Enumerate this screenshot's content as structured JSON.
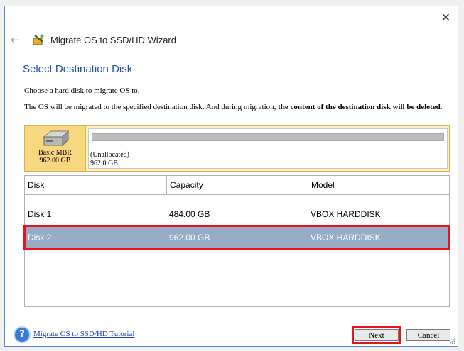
{
  "window": {
    "title": "Migrate OS to SSD/HD Wizard",
    "close_glyph": "✕"
  },
  "page": {
    "heading": "Select Destination Disk",
    "instruction": "Choose a hard disk to migrate OS to.",
    "warning_prefix": "The OS will be migrated to the specified destination disk. And during migration, ",
    "warning_bold": "the content of the destination disk will be deleted",
    "warning_suffix": "."
  },
  "disk_map": {
    "disk_type": "Basic MBR",
    "disk_size": "962.00 GB",
    "partition_label": "(Unallocated)",
    "partition_size": "962.0 GB"
  },
  "table": {
    "columns": [
      "Disk",
      "Capacity",
      "Model"
    ],
    "rows": [
      {
        "disk": "Disk 1",
        "capacity": "484.00 GB",
        "model": "VBOX HARDDISK"
      },
      {
        "disk": "Disk 2",
        "capacity": "962.00 GB",
        "model": "VBOX HARDDISK"
      }
    ],
    "selected_row": 1
  },
  "footer": {
    "help_glyph": "?",
    "tutorial_link": "Migrate OS to SSD/HD Tutorial",
    "next_label": "Next",
    "cancel_label": "Cancel"
  },
  "colors": {
    "accent": "#1e4f9a",
    "selection": "#98acc8",
    "highlight": "#e8141c"
  },
  "icons": [
    "back-arrow-icon",
    "wizard-icon",
    "hard-disk-icon",
    "help-icon",
    "resize-grip-icon"
  ]
}
